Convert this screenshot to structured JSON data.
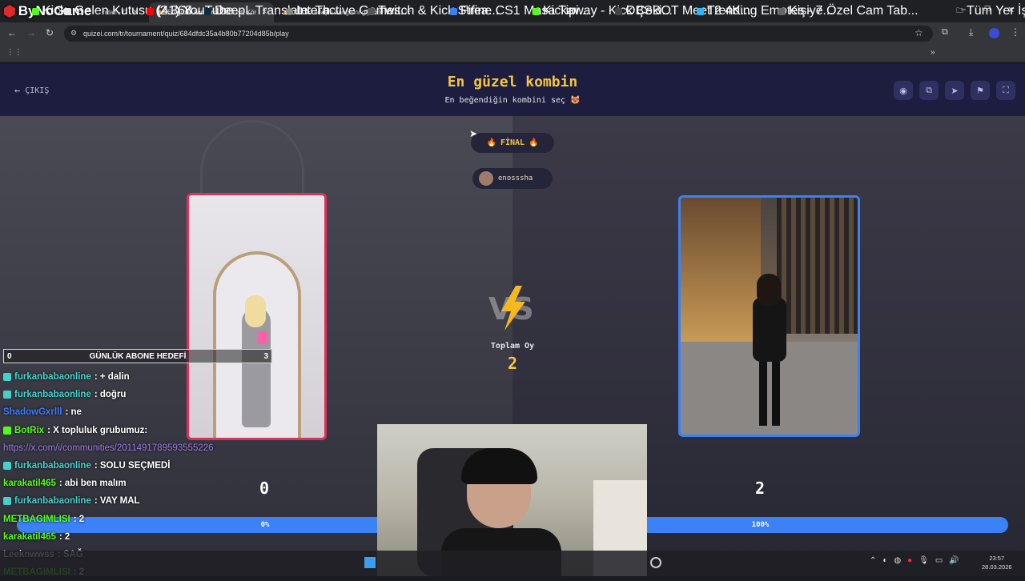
{
  "browser": {
    "tabs": [
      {
        "label": "ndan - D"
      },
      {
        "label": "En güzel kombin - Tier List, Kör"
      },
      {
        "label": "Kız arkadaşın hangisini giyebilir"
      }
    ],
    "url": "quizei.com/tr/tournament/quiz/684dfdc35a4b80b77204d85b/play",
    "bookmarks": [
      {
        "label": "Kick",
        "color": "#53fc18"
      },
      {
        "label": "Gelen Kutusu (2.368..."
      },
      {
        "label": "(41) YouTube",
        "color": "#ff0000"
      },
      {
        "label": "DeepL Translate: Th..."
      },
      {
        "label": "Interactive Games..."
      },
      {
        "label": "Twitch & Kick Strea..."
      },
      {
        "label": "Fifine CS1 Masa Tipi..."
      },
      {
        "label": "Kickaway - Kick Çeki..."
      },
      {
        "label": "OBSBOT Meet 2 4K..."
      },
      {
        "label": "Trending Emotes - 7..."
      },
      {
        "label": "Kişiye Özel Cam Tab..."
      }
    ],
    "bookmarks_all": "Tüm Yer İşaretleri"
  },
  "logo": {
    "text": "ByNoGame"
  },
  "quiz": {
    "exit_label": "ÇIKIŞ",
    "title": "En güzel kombin",
    "subtitle": "En beğendiğin kombini seç 😻",
    "round_label": "FİNAL",
    "round_emoji": "🔥",
    "username": "enosssha",
    "vs_label": "VS",
    "total_votes_label": "Toplam Oy",
    "total_votes": "2",
    "left": {
      "score": "0",
      "percent_label": "0%",
      "percent": 0
    },
    "right": {
      "score": "2",
      "percent_label": "100%",
      "percent": 100
    }
  },
  "overlay": {
    "sub_goal": {
      "current": "0",
      "label": "GÜNLÜK ABONE HEDEFİ",
      "target": "3"
    },
    "chat": [
      {
        "user": "furkanbabaonline",
        "text": ": + dalin",
        "color": "#45d1c9",
        "badge": true
      },
      {
        "user": "furkanbabaonline",
        "text": ": doğru",
        "color": "#45d1c9",
        "badge": true
      },
      {
        "user": "ShadowGxrlll",
        "text": ": ne",
        "color": "#3b7dff",
        "badge": false
      },
      {
        "user": "BotRix",
        "text": ": X topluluk grubumuz:",
        "color": "#53fc18",
        "badge": true
      },
      {
        "user": "",
        "text": "https://x.com/i/communities/2011491789593555226",
        "color": "#9c79e6",
        "badge": false,
        "link": true
      },
      {
        "user": "furkanbabaonline",
        "text": ": SOLU SEÇMEDİ",
        "color": "#45d1c9",
        "badge": true
      },
      {
        "user": "karakatil465",
        "text": ": abi ben malım",
        "color": "#53fc18",
        "badge": false
      },
      {
        "user": "furkanbabaonline",
        "text": ": VAY MAL",
        "color": "#45d1c9",
        "badge": true
      },
      {
        "user": "METBAGIMLISI",
        "text": ": 2",
        "color": "#53fc18",
        "badge": false
      },
      {
        "user": "karakatil465",
        "text": ": 2",
        "color": "#53fc18",
        "badge": false
      },
      {
        "user": "Leeknwwss",
        "text": ": SAĞ",
        "color": "#ffffff",
        "badge": false
      },
      {
        "user": "METBAGIMLISI",
        "text": ": 2",
        "color": "#53fc18",
        "badge": false
      }
    ]
  },
  "taskbar": {
    "time": "23:57",
    "date": "28.03.2026"
  }
}
